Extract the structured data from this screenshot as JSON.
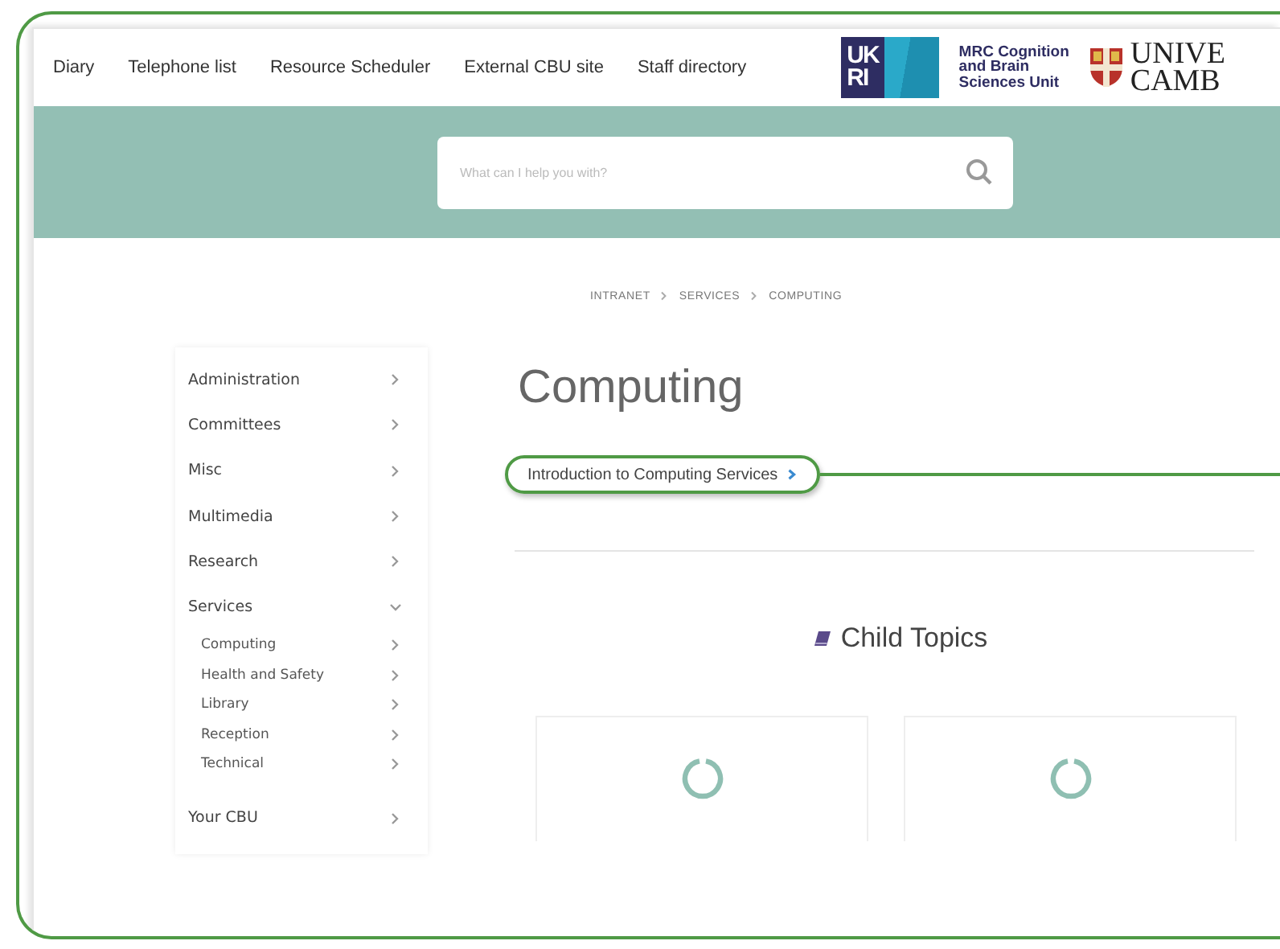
{
  "nav": {
    "links": [
      "Diary",
      "Telephone list",
      "Resource Scheduler",
      "External CBU site",
      "Staff directory"
    ]
  },
  "logos": {
    "ukri": [
      "UK",
      "RI"
    ],
    "mrc": [
      "MRC Cognition",
      "and Brain",
      "Sciences Unit"
    ],
    "cambridge": [
      "UNIVE",
      "CAMB"
    ]
  },
  "search": {
    "placeholder": "What can I help you with?"
  },
  "breadcrumb": [
    "INTRANET",
    "SERVICES",
    "COMPUTING"
  ],
  "sidebar": {
    "items": [
      {
        "label": "Administration",
        "expanded": false
      },
      {
        "label": "Committees",
        "expanded": false
      },
      {
        "label": "Misc",
        "expanded": false
      },
      {
        "label": "Multimedia",
        "expanded": false
      },
      {
        "label": "Research",
        "expanded": false
      },
      {
        "label": "Services",
        "expanded": true,
        "children": [
          {
            "label": "Computing"
          },
          {
            "label": "Health and Safety"
          },
          {
            "label": "Library"
          },
          {
            "label": "Reception"
          },
          {
            "label": "Technical"
          }
        ]
      },
      {
        "label": "Your CBU",
        "expanded": false
      }
    ]
  },
  "page": {
    "title": "Computing",
    "links": [
      {
        "label": "Introduction to Computing Services",
        "highlighted": true
      }
    ],
    "child_topics": {
      "heading": "Child Topics",
      "cards": [
        {
          "kind": "loading"
        },
        {
          "kind": "loading"
        }
      ]
    }
  }
}
